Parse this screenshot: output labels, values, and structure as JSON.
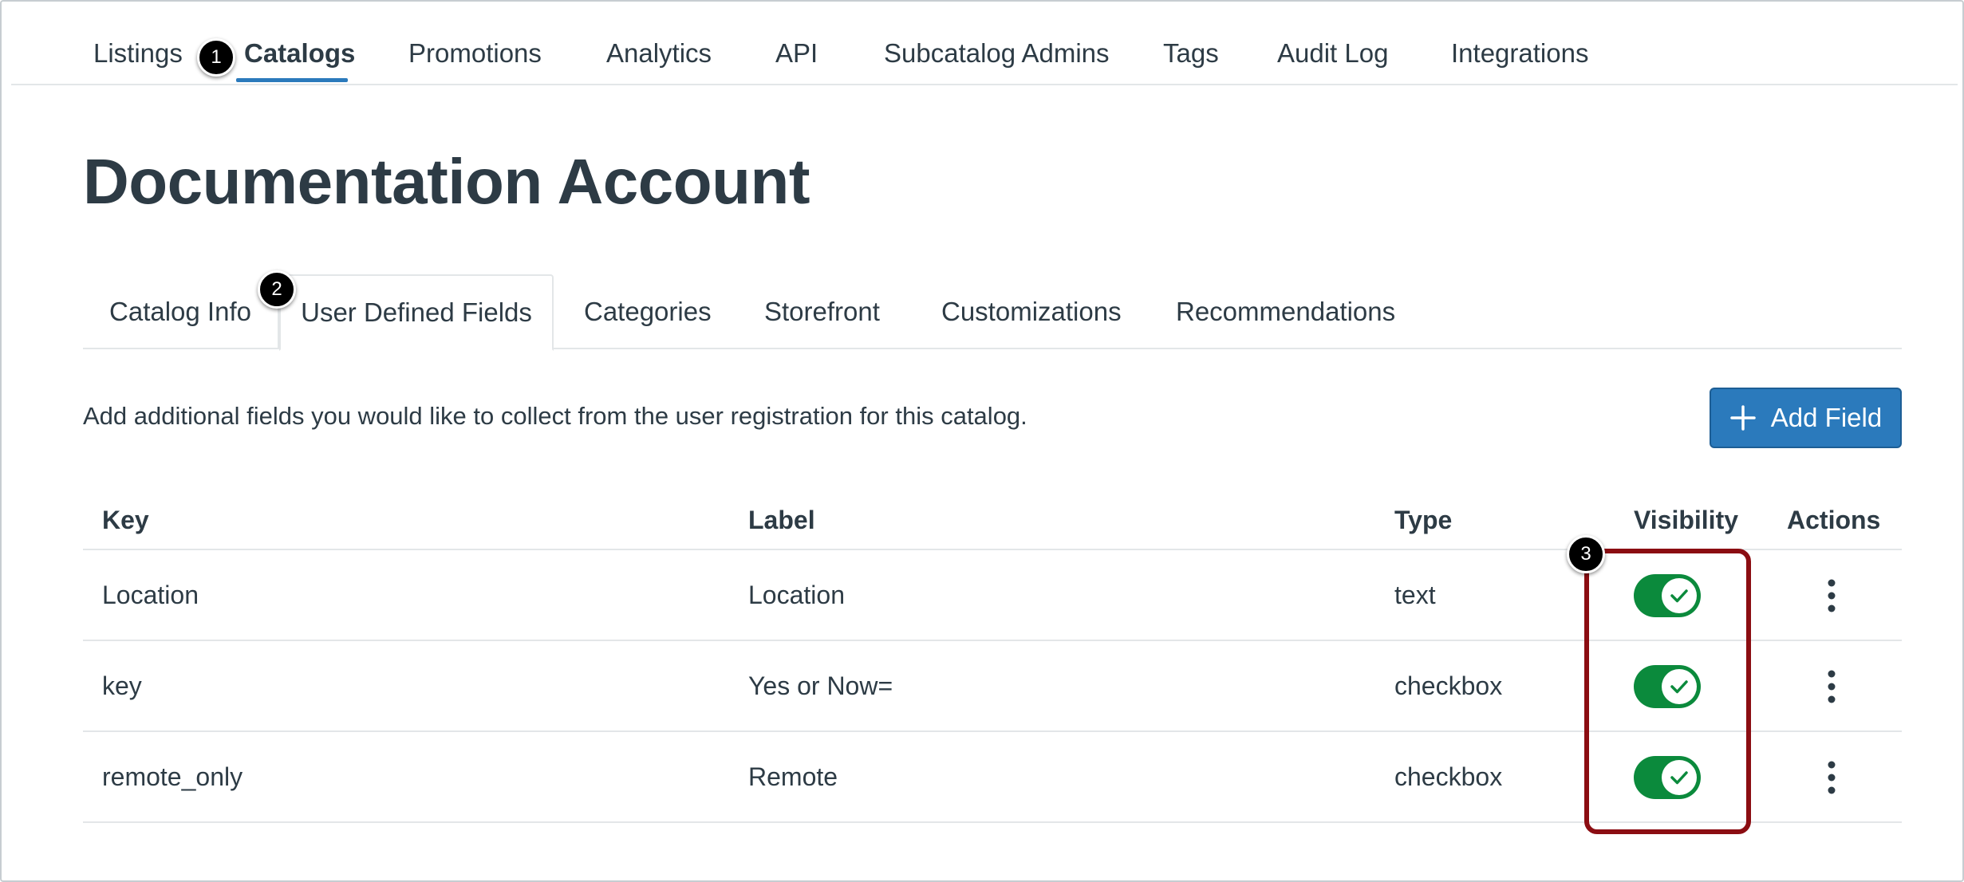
{
  "top_nav": {
    "items": [
      {
        "label": "Listings"
      },
      {
        "label": "Catalogs",
        "active": true
      },
      {
        "label": "Promotions"
      },
      {
        "label": "Analytics"
      },
      {
        "label": "API"
      },
      {
        "label": "Subcatalog Admins"
      },
      {
        "label": "Tags"
      },
      {
        "label": "Audit Log"
      },
      {
        "label": "Integrations"
      }
    ]
  },
  "callouts": [
    "1",
    "2",
    "3"
  ],
  "page": {
    "title": "Documentation Account"
  },
  "sub_tabs": {
    "items": [
      {
        "label": "Catalog Info"
      },
      {
        "label": "User Defined Fields",
        "active": true
      },
      {
        "label": "Categories"
      },
      {
        "label": "Storefront"
      },
      {
        "label": "Customizations"
      },
      {
        "label": "Recommendations"
      }
    ]
  },
  "content": {
    "description": "Add additional fields you would like to collect from the user registration for this catalog.",
    "add_button_label": "Add Field"
  },
  "table": {
    "headers": {
      "key": "Key",
      "label": "Label",
      "type": "Type",
      "visibility": "Visibility",
      "actions": "Actions"
    },
    "rows": [
      {
        "key": "Location",
        "label": "Location",
        "type": "text",
        "visible": true
      },
      {
        "key": "key",
        "label": "Yes or Now=",
        "type": "checkbox",
        "visible": true
      },
      {
        "key": "remote_only",
        "label": "Remote",
        "type": "checkbox",
        "visible": true
      }
    ]
  },
  "colors": {
    "accent": "#2b7abc",
    "toggle_on": "#0b8a3c",
    "highlight": "#8b0d12",
    "text": "#2d3b45"
  }
}
